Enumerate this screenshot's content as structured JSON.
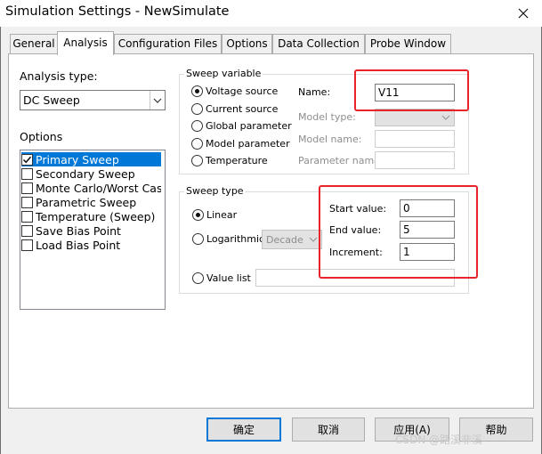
{
  "window": {
    "title": "Simulation Settings - NewSimulate"
  },
  "tabs": [
    "General",
    "Analysis",
    "Configuration Files",
    "Options",
    "Data Collection",
    "Probe Window"
  ],
  "left": {
    "analysis_type_label": "Analysis type:",
    "analysis_type_value": "DC Sweep",
    "options_label": "Options",
    "options": [
      "Primary Sweep",
      "Secondary Sweep",
      "Monte Carlo/Worst Case",
      "Parametric Sweep",
      "Temperature (Sweep)",
      "Save Bias Point",
      "Load Bias Point"
    ]
  },
  "sweep_variable": {
    "title": "Sweep variable",
    "voltage_source": "Voltage source",
    "current_source": "Current source",
    "global_parameter": "Global parameter",
    "model_parameter": "Model parameter",
    "temperature": "Temperature",
    "name_label": "Name:",
    "name_value": "V11",
    "model_type_label": "Model type:",
    "model_name_label": "Model name:",
    "parameter_name_label": "Parameter name:"
  },
  "sweep_type": {
    "title": "Sweep type",
    "linear": "Linear",
    "logarithmic": "Logarithmic",
    "log_scale": "Decade",
    "value_list": "Value list",
    "start_label": "Start value:",
    "start_value": "0",
    "end_label": "End value:",
    "end_value": "5",
    "increment_label": "Increment:",
    "increment_value": "1"
  },
  "buttons": {
    "ok": "确定",
    "cancel": "取消",
    "apply": "应用(A)",
    "help": "帮助"
  },
  "watermark": "CSDN @路溪非溪",
  "colors": {
    "highlight_box": "#e8242a",
    "selection": "#0078d7"
  }
}
